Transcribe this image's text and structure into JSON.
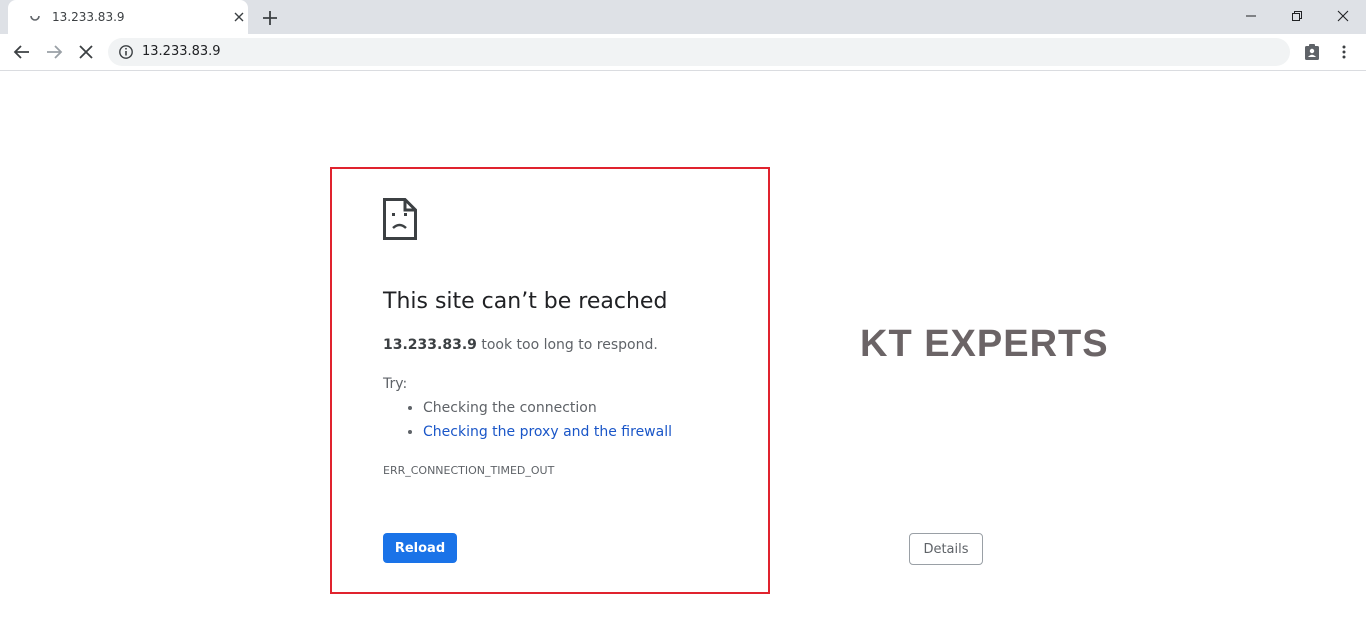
{
  "tab": {
    "title": "13.233.83.9",
    "spinner_icon": "loading-spinner-icon",
    "close_icon": "close-icon"
  },
  "window_controls": [
    "minimize-icon",
    "restore-icon",
    "close-icon"
  ],
  "toolbar": {
    "back_icon": "arrow-left-icon",
    "forward_icon": "arrow-right-icon",
    "stop_icon": "stop-x-icon",
    "address": "13.233.83.9",
    "info_icon": "info-circle-icon",
    "profile_icon": "clipboard-account-icon",
    "menu_icon": "vertical-dots-icon"
  },
  "error": {
    "title": "This site can’t be reached",
    "host": "13.233.83.9",
    "message_suffix": " took too long to respond.",
    "try_label": "Try:",
    "suggestions": [
      {
        "text": "Checking the connection",
        "link": false
      },
      {
        "text": "Checking the proxy and the firewall",
        "link": true
      }
    ],
    "code": "ERR_CONNECTION_TIMED_OUT",
    "reload_label": "Reload",
    "details_label": "Details"
  },
  "watermark": "KT EXPERTS",
  "colors": {
    "accent": "#1a73e8",
    "link": "#1a56c8",
    "highlight_frame": "#e0232e",
    "tabstrip": "#dee1e6"
  }
}
